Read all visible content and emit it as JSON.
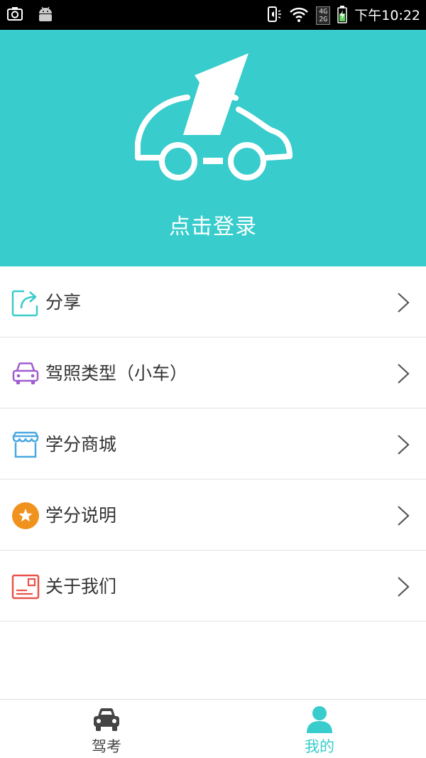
{
  "status_bar": {
    "network_top": "4G",
    "network_bottom": "2G",
    "time": "下午10:22",
    "icons": [
      "camera-icon",
      "android-icon",
      "vibrate-icon",
      "wifi-icon",
      "battery-charging-icon"
    ]
  },
  "header": {
    "login_label": "点击登录",
    "background_color": "#38cccc"
  },
  "menu": {
    "items": [
      {
        "label": "分享",
        "icon": "share-icon",
        "icon_color": "#38cccc"
      },
      {
        "label": "驾照类型（小车）",
        "icon": "car-type-icon",
        "icon_color": "#a05bd0"
      },
      {
        "label": "学分商城",
        "icon": "store-icon",
        "icon_color": "#4aa7e0"
      },
      {
        "label": "学分说明",
        "icon": "star-badge-icon",
        "icon_color": "#f0921e"
      },
      {
        "label": "关于我们",
        "icon": "about-card-icon",
        "icon_color": "#e8534a"
      }
    ]
  },
  "tabbar": {
    "tabs": [
      {
        "label": "驾考",
        "icon": "car-icon",
        "active": false
      },
      {
        "label": "我的",
        "icon": "user-icon",
        "active": true
      }
    ],
    "active_color": "#38cccc"
  }
}
